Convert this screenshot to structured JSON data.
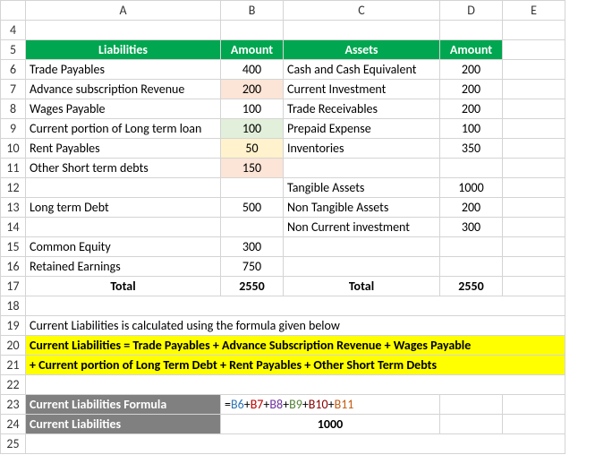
{
  "columns": {
    "A": "A",
    "B": "B",
    "C": "C",
    "D": "D",
    "E": "E"
  },
  "rows": {
    "r4": "4",
    "r5": "5",
    "r6": "6",
    "r7": "7",
    "r8": "8",
    "r9": "9",
    "r10": "10",
    "r11": "11",
    "r12": "12",
    "r13": "13",
    "r14": "14",
    "r15": "15",
    "r16": "16",
    "r17": "17",
    "r18": "18",
    "r19": "19",
    "r20": "20",
    "r21": "21",
    "r22": "22",
    "r23": "23",
    "r24": "24",
    "r25": "25"
  },
  "headers": {
    "liabilities": "Liabilities",
    "amount1": "Amount",
    "assets": "Assets",
    "amount2": "Amount"
  },
  "liabilities_rows": [
    {
      "label": "Trade Payables",
      "amount": "400"
    },
    {
      "label": "Advance subscription Revenue",
      "amount": "200"
    },
    {
      "label": "Wages Payable",
      "amount": "100"
    },
    {
      "label": "Current portion of Long term loan",
      "amount": "100"
    },
    {
      "label": "Rent Payables",
      "amount": "50"
    },
    {
      "label": "Other Short term debts",
      "amount": "150"
    }
  ],
  "liabilities_extra": [
    {
      "label": "Long term Debt",
      "amount": "500"
    },
    {
      "label": "Common Equity",
      "amount": "300"
    },
    {
      "label": "Retained Earnings",
      "amount": "750"
    }
  ],
  "assets_rows": [
    {
      "label": "Cash and Cash Equivalent",
      "amount": "200"
    },
    {
      "label": "Current Investment",
      "amount": "200"
    },
    {
      "label": "Trade Receivables",
      "amount": "200"
    },
    {
      "label": "Prepaid Expense",
      "amount": "100"
    },
    {
      "label": "Inventories",
      "amount": "350"
    }
  ],
  "assets_extra": [
    {
      "label": "Tangible Assets",
      "amount": "1000"
    },
    {
      "label": "Non Tangible Assets",
      "amount": "200"
    },
    {
      "label": "Non Current investment",
      "amount": "300"
    }
  ],
  "totals": {
    "label": "Total",
    "liab": "2550",
    "assets_label": "Total",
    "assets": "2550"
  },
  "note": "Current Liabilities is calculated using the formula given below",
  "formula_text1": "Current Liabilities = Trade Payables + Advance Subscription Revenue + Wages Payable",
  "formula_text2": " + Current portion of Long Term Debt + Rent Payables + Other Short Term Debts",
  "result_box": {
    "formula_label": "Current Liabilities Formula",
    "value_label": "Current Liabilities",
    "formula_parts": {
      "eq": "=",
      "p1": "B6",
      "p2": "B7",
      "p3": "B8",
      "p4": "B9",
      "p5": "B10",
      "p6": "B11",
      "plus": "+"
    },
    "value": "1000"
  },
  "chart_data": {
    "type": "table",
    "title": "Balance Sheet with Current Liabilities Computation",
    "liabilities": [
      {
        "item": "Trade Payables",
        "amount": 400
      },
      {
        "item": "Advance subscription Revenue",
        "amount": 200
      },
      {
        "item": "Wages Payable",
        "amount": 100
      },
      {
        "item": "Current portion of Long term loan",
        "amount": 100
      },
      {
        "item": "Rent Payables",
        "amount": 50
      },
      {
        "item": "Other Short term debts",
        "amount": 150
      },
      {
        "item": "Long term Debt",
        "amount": 500
      },
      {
        "item": "Common Equity",
        "amount": 300
      },
      {
        "item": "Retained Earnings",
        "amount": 750
      }
    ],
    "liabilities_total": 2550,
    "assets": [
      {
        "item": "Cash and Cash Equivalent",
        "amount": 200
      },
      {
        "item": "Current Investment",
        "amount": 200
      },
      {
        "item": "Trade Receivables",
        "amount": 200
      },
      {
        "item": "Prepaid Expense",
        "amount": 100
      },
      {
        "item": "Inventories",
        "amount": 350
      },
      {
        "item": "Tangible Assets",
        "amount": 1000
      },
      {
        "item": "Non Tangible Assets",
        "amount": 200
      },
      {
        "item": "Non Current investment",
        "amount": 300
      }
    ],
    "assets_total": 2550,
    "current_liabilities_formula": "=B6+B7+B8+B9+B10+B11",
    "current_liabilities_value": 1000
  }
}
